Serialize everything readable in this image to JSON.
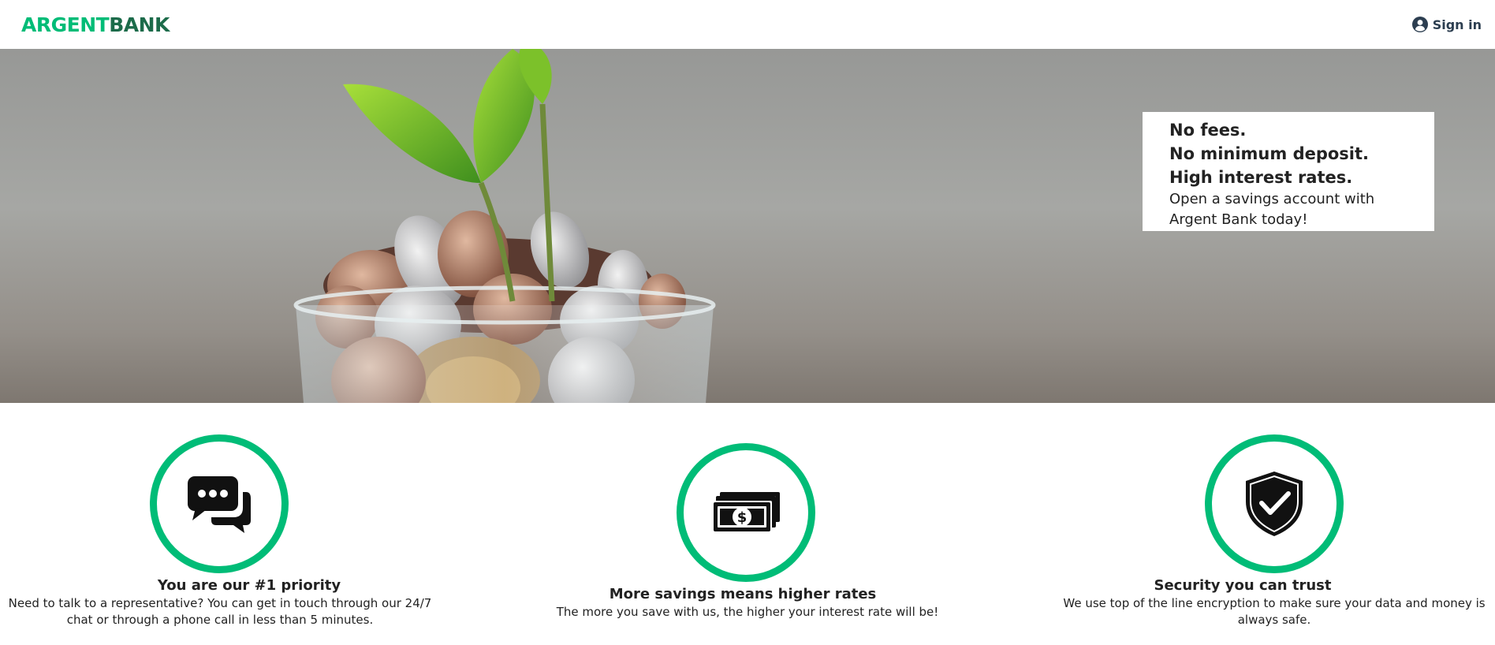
{
  "nav": {
    "logo_part1": "ARGENT",
    "logo_part2": "BANK",
    "signin_label": "Sign in",
    "signin_icon": "user-circle-icon"
  },
  "hero": {
    "subtitles": [
      "No fees.",
      "No minimum deposit.",
      "High interest rates."
    ],
    "text": "Open a savings account with Argent Bank today!",
    "image": "plant-growing-from-coins-jar"
  },
  "features": [
    {
      "icon": "chat-icon",
      "title": "You are our #1 priority",
      "description": "Need to talk to a representative? You can get in touch through our 24/7 chat or through a phone call in less than 5 minutes."
    },
    {
      "icon": "money-icon",
      "title": "More savings means higher rates",
      "description": "The more you save with us, the higher your interest rate will be!"
    },
    {
      "icon": "security-shield-icon",
      "title": "Security you can trust",
      "description": "We use top of the line encryption to make sure your data and money is always safe."
    }
  ],
  "colors": {
    "accent": "#00bc77",
    "logo_dark": "#1c6b4a",
    "text": "#2c3e50"
  }
}
